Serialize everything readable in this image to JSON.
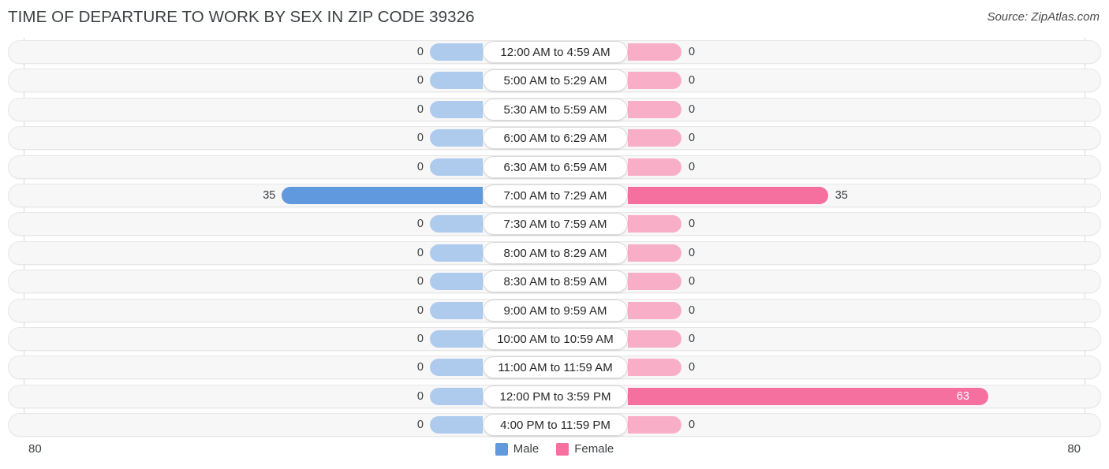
{
  "header": {
    "title": "TIME OF DEPARTURE TO WORK BY SEX IN ZIP CODE 39326",
    "source": "Source: ZipAtlas.com"
  },
  "legend": {
    "male_label": "Male",
    "female_label": "Female",
    "male_color": "#6099dd",
    "female_color": "#f5709f"
  },
  "axis": {
    "left_tick": "80",
    "right_tick": "80",
    "max": 80
  },
  "chart_data": {
    "type": "bar",
    "orientation": "horizontal-diverging",
    "title": "TIME OF DEPARTURE TO WORK BY SEX IN ZIP CODE 39326",
    "xlabel": "",
    "ylabel": "",
    "xlim": [
      0,
      80
    ],
    "grid": false,
    "legend_position": "bottom-center",
    "categories": [
      "12:00 AM to 4:59 AM",
      "5:00 AM to 5:29 AM",
      "5:30 AM to 5:59 AM",
      "6:00 AM to 6:29 AM",
      "6:30 AM to 6:59 AM",
      "7:00 AM to 7:29 AM",
      "7:30 AM to 7:59 AM",
      "8:00 AM to 8:29 AM",
      "8:30 AM to 8:59 AM",
      "9:00 AM to 9:59 AM",
      "10:00 AM to 10:59 AM",
      "11:00 AM to 11:59 AM",
      "12:00 PM to 3:59 PM",
      "4:00 PM to 11:59 PM"
    ],
    "series": [
      {
        "name": "Male",
        "color": "#6099dd",
        "values": [
          0,
          0,
          0,
          0,
          0,
          35,
          0,
          0,
          0,
          0,
          0,
          0,
          0,
          0
        ]
      },
      {
        "name": "Female",
        "color": "#f5709f",
        "values": [
          0,
          0,
          0,
          0,
          0,
          35,
          0,
          0,
          0,
          0,
          0,
          0,
          63,
          0
        ]
      }
    ]
  }
}
